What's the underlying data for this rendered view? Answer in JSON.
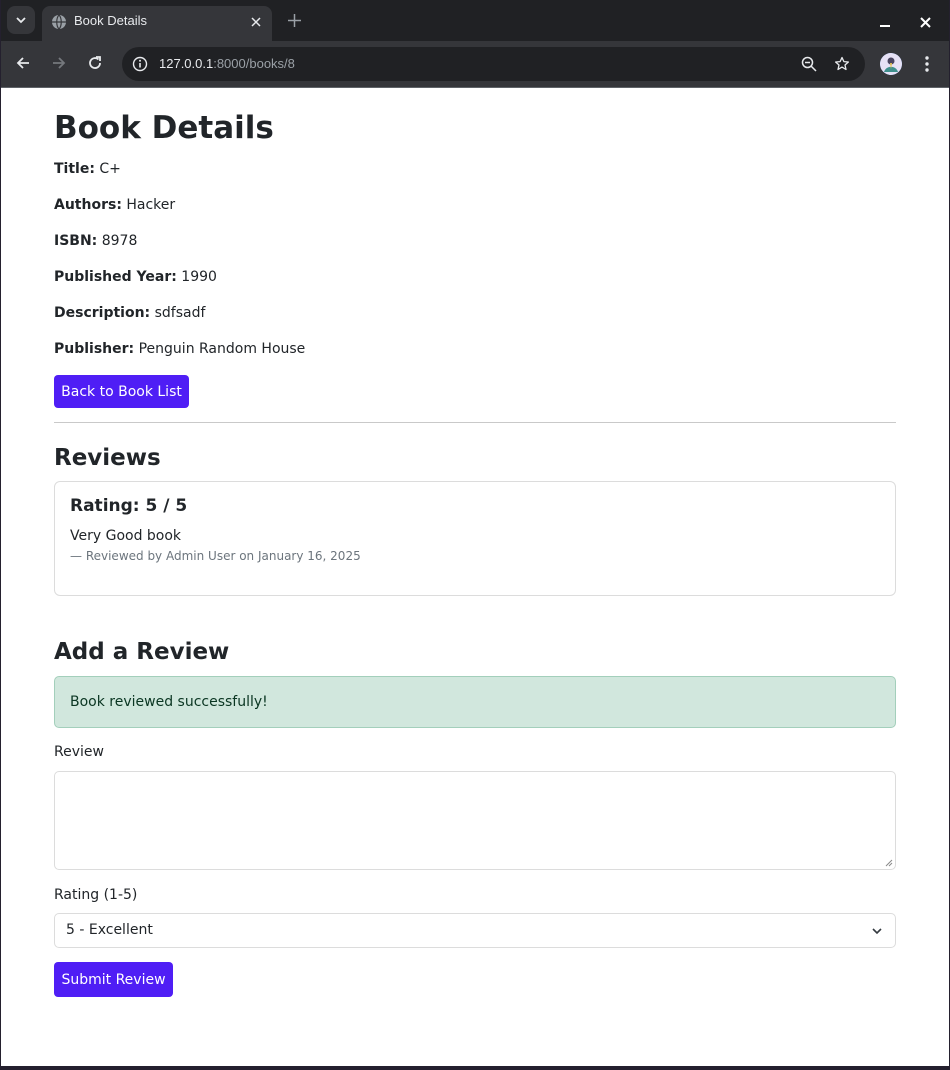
{
  "browser": {
    "tab_title": "Book Details",
    "url_host": "127.0.0.1",
    "url_path": ":8000/books/8"
  },
  "page": {
    "heading": "Book Details",
    "details": [
      {
        "label": "Title:",
        "value": "C+"
      },
      {
        "label": "Authors:",
        "value": "Hacker"
      },
      {
        "label": "ISBN:",
        "value": "8978"
      },
      {
        "label": "Published Year:",
        "value": "1990"
      },
      {
        "label": "Description:",
        "value": "sdfsadf"
      },
      {
        "label": "Publisher:",
        "value": "Penguin Random House"
      }
    ],
    "back_button": "Back to Book List"
  },
  "reviews": {
    "heading": "Reviews",
    "items": [
      {
        "rating": "Rating: 5 / 5",
        "text": "Very Good book",
        "meta": "—  Reviewed by Admin User on January 16, 2025"
      }
    ]
  },
  "add_review": {
    "heading": "Add a Review",
    "alert": "Book reviewed successfully!",
    "review_label": "Review",
    "review_value": "",
    "rating_label": "Rating (1-5)",
    "rating_selected": "5 - Excellent",
    "submit_label": "Submit Review"
  },
  "colors": {
    "primary": "#4f1ef5",
    "alert_bg": "#d1e7dd",
    "alert_text": "#0a3622"
  }
}
